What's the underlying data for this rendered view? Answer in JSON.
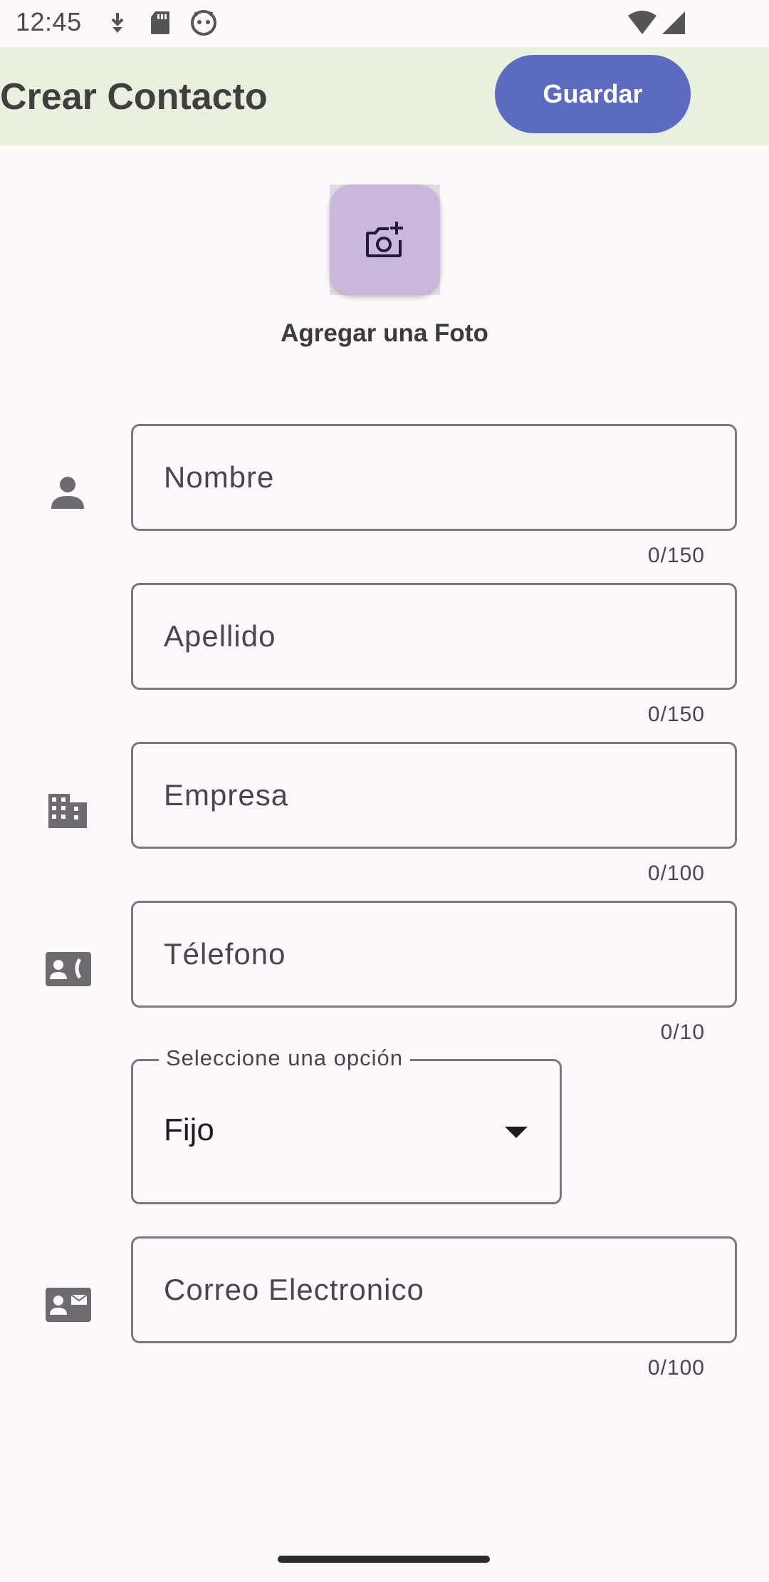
{
  "status_bar": {
    "time": "12:45",
    "icons": [
      "download-icon",
      "sd-card-icon",
      "android-icon",
      "wifi-icon",
      "signal-icon"
    ]
  },
  "app_bar": {
    "title": "Crear Contacto",
    "save_label": "Guardar"
  },
  "photo": {
    "label": "Agregar una Foto",
    "icon": "add-a-photo-icon"
  },
  "fields": [
    {
      "placeholder": "Nombre",
      "counter": "0/150",
      "icon": "person-icon"
    },
    {
      "placeholder": "Apellido",
      "counter": "0/150",
      "icon": ""
    },
    {
      "placeholder": "Empresa",
      "counter": "0/100",
      "icon": "business-icon"
    },
    {
      "placeholder": "Télefono",
      "counter": "0/10",
      "icon": "contact-phone-icon"
    },
    {
      "placeholder": "Correo Electronico",
      "counter": "0/100",
      "icon": "contact-mail-icon"
    }
  ],
  "phone_type": {
    "label": "Seleccione una opción",
    "value": "Fijo"
  },
  "colors": {
    "app_bar_bg": "#e9f0dd",
    "primary": "#5c6bc0",
    "photo_bg": "#c9b8dc",
    "background": "#fdf8fc"
  }
}
